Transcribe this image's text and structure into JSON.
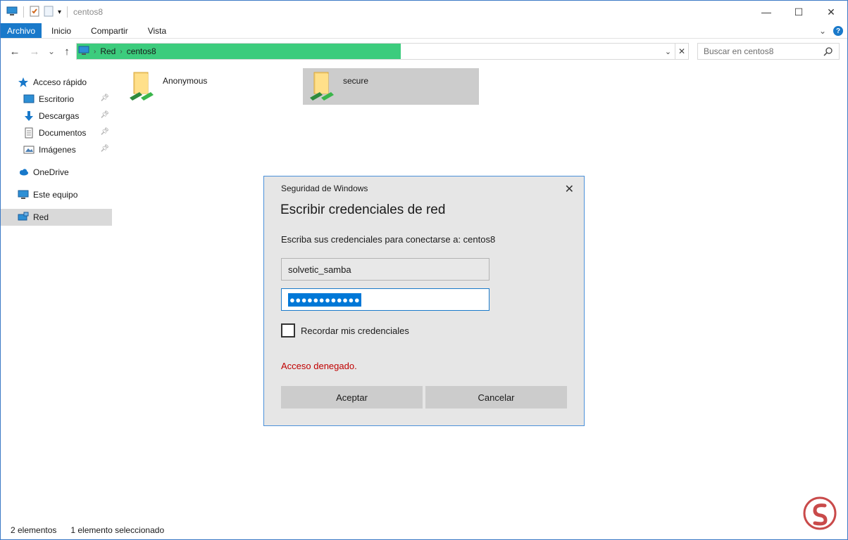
{
  "window": {
    "title": "centos8",
    "controls": {
      "minimize": "—",
      "maximize": "☐",
      "close": "✕"
    }
  },
  "ribbon": {
    "tabs": [
      "Archivo",
      "Inicio",
      "Compartir",
      "Vista"
    ],
    "expand_icon": "chevron-down-icon",
    "help_icon": "?"
  },
  "navigation": {
    "back": "←",
    "forward": "→",
    "recent": "⌄",
    "up": "↑",
    "breadcrumb": [
      "Red",
      "centos8"
    ],
    "load_progress_pct": 53,
    "search_placeholder": "Buscar en centos8"
  },
  "sidebar": {
    "items": [
      {
        "label": "Acceso rápido",
        "icon": "star-icon",
        "level": "top"
      },
      {
        "label": "Escritorio",
        "icon": "desktop-icon",
        "level": "sub",
        "pinned": true
      },
      {
        "label": "Descargas",
        "icon": "download-icon",
        "level": "sub",
        "pinned": true
      },
      {
        "label": "Documentos",
        "icon": "document-icon",
        "level": "sub",
        "pinned": true
      },
      {
        "label": "Imágenes",
        "icon": "pictures-icon",
        "level": "sub",
        "pinned": true
      },
      {
        "label": "OneDrive",
        "icon": "cloud-icon",
        "level": "top"
      },
      {
        "label": "Este equipo",
        "icon": "computer-icon",
        "level": "top"
      },
      {
        "label": "Red",
        "icon": "network-icon",
        "level": "top",
        "selected": true
      }
    ]
  },
  "content": {
    "folders": [
      {
        "name": "Anonymous",
        "selected": false
      },
      {
        "name": "secure",
        "selected": true
      }
    ]
  },
  "status": {
    "count": "2 elementos",
    "selection": "1 elemento seleccionado"
  },
  "dialog": {
    "title": "Seguridad de Windows",
    "heading": "Escribir credenciales de red",
    "prompt": "Escriba sus credenciales para conectarse a: centos8",
    "username": "solvetic_samba",
    "password_mask": "●●●●●●●●●●●●",
    "remember_label": "Recordar mis credenciales",
    "remember_checked": false,
    "error": "Acceso denegado.",
    "ok_label": "Aceptar",
    "cancel_label": "Cancelar",
    "close": "✕"
  },
  "colors": {
    "accent": "#1979ca",
    "progress": "#3ccc7d",
    "error": "#c00000",
    "selection": "#cccccc"
  }
}
